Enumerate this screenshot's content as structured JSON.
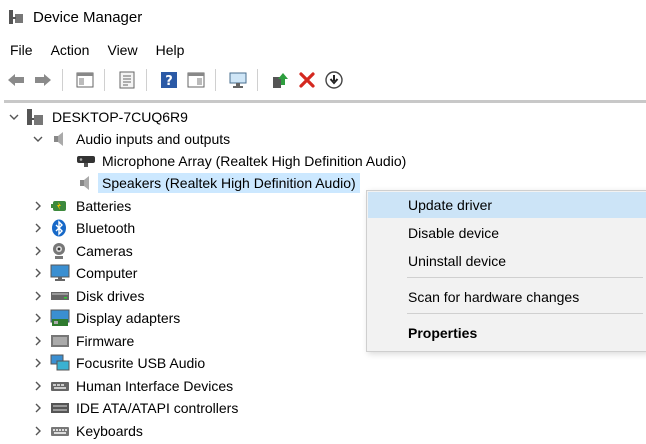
{
  "window": {
    "title": "Device Manager"
  },
  "menu": [
    "File",
    "Action",
    "View",
    "Help"
  ],
  "toolbar": {
    "icons": [
      "back-arrow-icon",
      "forward-arrow-icon",
      "properties-pane-icon",
      "device-list-icon",
      "help-icon",
      "properties-icon",
      "scan-hardware-icon",
      "update-driver-icon",
      "uninstall-icon",
      "disable-icon"
    ]
  },
  "tree": {
    "root": "DESKTOP-7CUQ6R9",
    "audio": {
      "label": "Audio inputs and outputs",
      "children": [
        "Microphone Array (Realtek High Definition Audio)",
        "Speakers (Realtek High Definition Audio)"
      ]
    },
    "categories": [
      "Batteries",
      "Bluetooth",
      "Cameras",
      "Computer",
      "Disk drives",
      "Display adapters",
      "Firmware",
      "Focusrite USB Audio",
      "Human Interface Devices",
      "IDE ATA/ATAPI controllers",
      "Keyboards"
    ]
  },
  "context_menu": {
    "items": [
      "Update driver",
      "Disable device",
      "Uninstall device",
      "Scan for hardware changes",
      "Properties"
    ]
  },
  "colors": {
    "selection": "#cce8ff",
    "menu_highlight": "#cce4f7",
    "menu_bg": "#f2f2f2",
    "delete_red": "#d4281f"
  }
}
